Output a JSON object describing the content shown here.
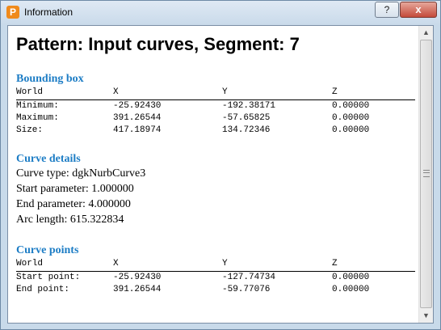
{
  "window": {
    "title": "Information",
    "app_icon_letter": "P",
    "help_label": "?",
    "close_label": "x"
  },
  "heading": "Pattern: Input curves, Segment: 7",
  "bounding_box": {
    "title": "Bounding box",
    "headers": [
      "World",
      "X",
      "Y",
      "Z"
    ],
    "rows": [
      [
        "Minimum:",
        "-25.92430",
        "-192.38171",
        "0.00000"
      ],
      [
        "Maximum:",
        "391.26544",
        "-57.65825",
        "0.00000"
      ],
      [
        "Size:",
        "417.18974",
        "134.72346",
        "0.00000"
      ]
    ]
  },
  "curve_details": {
    "title": "Curve details",
    "lines": [
      "Curve type: dgkNurbCurve3",
      "Start parameter: 1.000000",
      "End parameter: 4.000000",
      "Arc length: 615.322834"
    ]
  },
  "curve_points": {
    "title": "Curve points",
    "headers": [
      "World",
      "X",
      "Y",
      "Z"
    ],
    "rows": [
      [
        "Start point:",
        "-25.92430",
        "-127.74734",
        "0.00000"
      ],
      [
        "End point:",
        "391.26544",
        "-59.77076",
        "0.00000"
      ]
    ]
  },
  "scrollbar": {
    "up_arrow": "▲",
    "down_arrow": "▼"
  }
}
